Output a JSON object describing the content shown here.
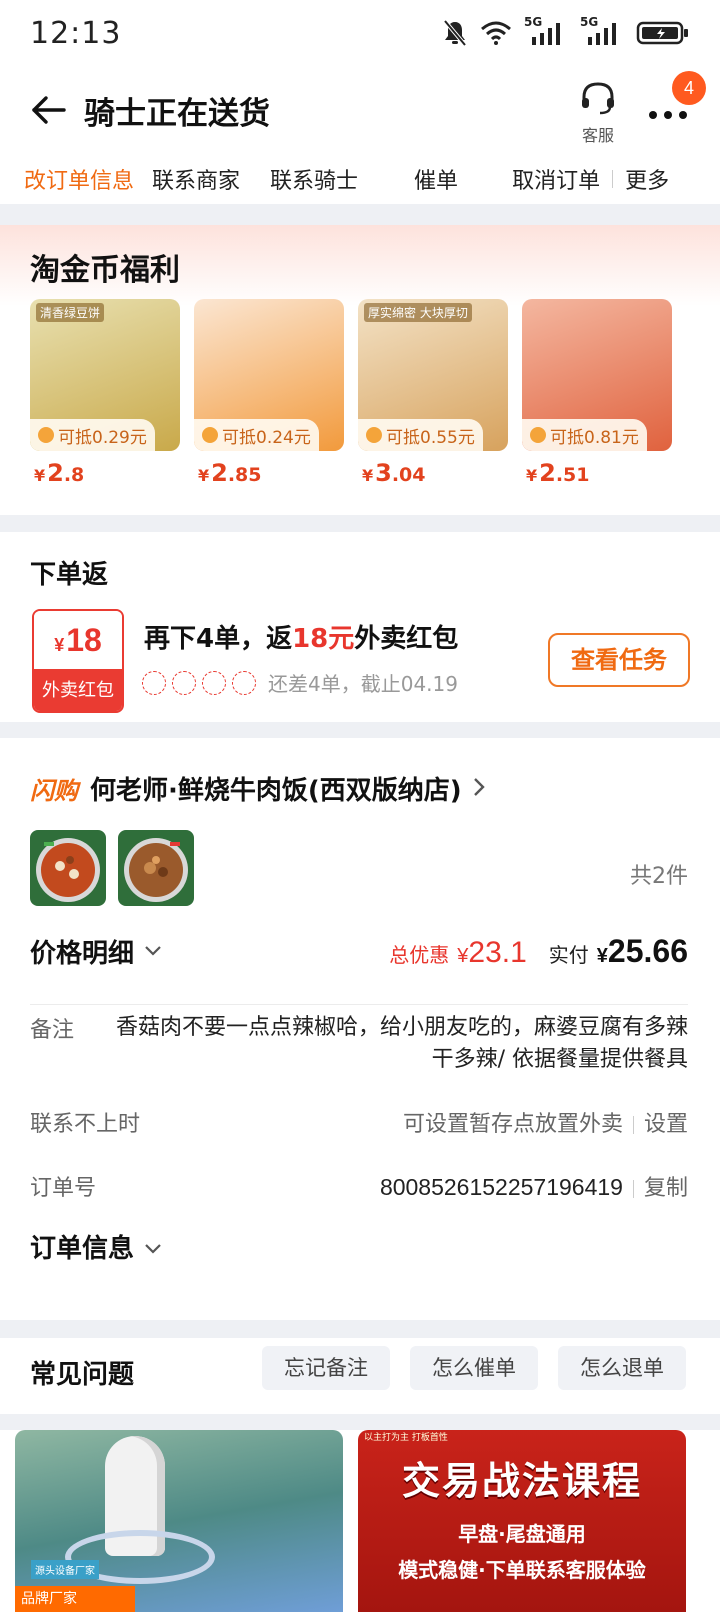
{
  "status": {
    "time": "12:13",
    "sim1": "5G",
    "sim2": "5G"
  },
  "nav": {
    "title": "骑士正在送货",
    "service_label": "客服",
    "badge_count": "4"
  },
  "actions": [
    "改订单信息",
    "联系商家",
    "联系骑士",
    "催单",
    "取消订单",
    "更多"
  ],
  "jinbi": {
    "title": "淘金币福利",
    "products": [
      {
        "deduct": "可抵0.29元",
        "yen": "¥",
        "int": "2",
        "dec": ".8",
        "img_tag": "清香绿豆饼",
        "colors": [
          "#e8e0b0",
          "#c9a94a"
        ]
      },
      {
        "deduct": "可抵0.24元",
        "yen": "¥",
        "int": "2",
        "dec": ".85",
        "img_tag": "",
        "colors": [
          "#fbe6d2",
          "#f29a3c"
        ]
      },
      {
        "deduct": "可抵0.55元",
        "yen": "¥",
        "int": "3",
        "dec": ".04",
        "img_tag": "厚实绵密 大块厚切",
        "colors": [
          "#f3e2c6",
          "#d7a25d"
        ]
      },
      {
        "deduct": "可抵0.81元",
        "yen": "¥",
        "int": "2",
        "dec": ".51",
        "img_tag": "",
        "colors": [
          "#f4b7a0",
          "#e0623e"
        ]
      }
    ]
  },
  "xiadanfan": {
    "title": "下单返",
    "redpack_yen": "¥",
    "redpack_amount": "18",
    "redpack_label": "外卖红包",
    "line_prefix": "再下4单，返",
    "line_highlight": "18元",
    "line_suffix": "外卖红包",
    "note": "还差4单，截止04.19",
    "button": "查看任务"
  },
  "order": {
    "flash_label": "闪购",
    "store_name": "何老师·鲜烧牛肉饭(西双版纳店)",
    "item_count": "共2件",
    "price_label": "价格明细",
    "discount_label": "总优惠",
    "discount_yen": "¥",
    "discount_value": "23.1",
    "paid_label": "实付",
    "paid_yen": "¥",
    "paid_value": "25.66",
    "remark_label": "备注",
    "remark_value": "香菇肉不要一点点辣椒哈，给小朋友吃的，麻婆豆腐有多辣干多辣/ 依据餐量提供餐具",
    "contact_label": "联系不上时",
    "contact_value": "可设置暂存点放置外卖",
    "contact_action": "设置",
    "orderno_label": "订单号",
    "orderno_value": "8008526152257196419",
    "orderno_action": "复制",
    "info_label": "订单信息"
  },
  "faq": {
    "title": "常见问题",
    "chips": [
      "忘记备注",
      "怎么催单",
      "怎么退单"
    ]
  },
  "ads": {
    "ad1_tag": "品牌厂家",
    "ad1_small": "源头设备厂家",
    "ad2_top": "以主打为主 打板首性",
    "ad2_headline": "交易战法课程",
    "ad2_sub1": "早盘·尾盘通用",
    "ad2_sub2": "模式稳健·下单联系客服体验"
  }
}
